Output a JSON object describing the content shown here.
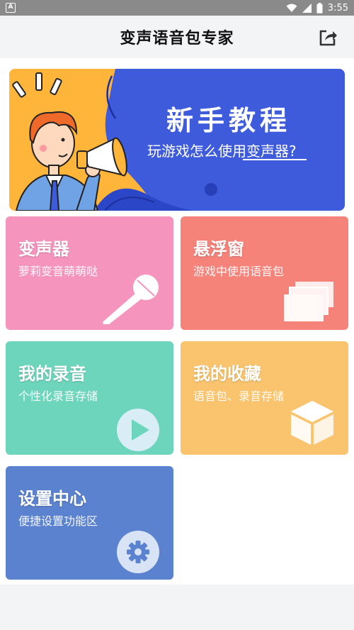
{
  "status_bar": {
    "time": "3:55",
    "notification_glyph": "A",
    "icons": [
      "wifi-icon",
      "signal-icon",
      "battery-icon"
    ]
  },
  "app_bar": {
    "title": "变声语音包专家",
    "share_icon": "share-icon"
  },
  "banner": {
    "title": "新手教程",
    "subtitle": "玩游戏怎么使用变声器?"
  },
  "cards": [
    {
      "title": "变声器",
      "subtitle": "萝莉变音萌萌哒",
      "icon": "microphone-icon",
      "color": "#f595be"
    },
    {
      "title": "悬浮窗",
      "subtitle": "游戏中使用语音包",
      "icon": "windows-stack-icon",
      "color": "#f6837a"
    },
    {
      "title": "我的录音",
      "subtitle": "个性化录音存储",
      "icon": "play-icon",
      "color": "#6ed5bd"
    },
    {
      "title": "我的收藏",
      "subtitle": "语音包、录音存储",
      "icon": "box-icon",
      "color": "#f9c46d"
    },
    {
      "title": "设置中心",
      "subtitle": "便捷设置功能区",
      "icon": "gear-icon",
      "color": "#5b82cf"
    }
  ]
}
